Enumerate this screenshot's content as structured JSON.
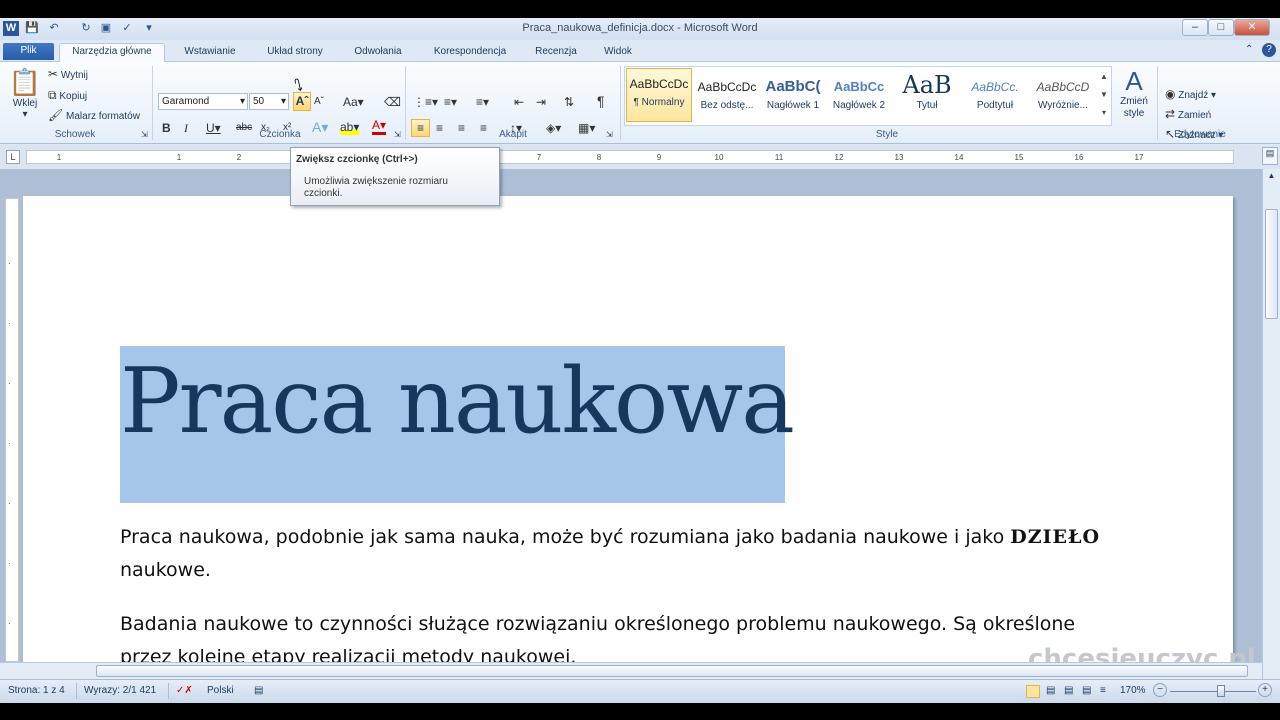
{
  "window": {
    "title": "Praca_naukowa_definicja.docx - Microsoft Word"
  },
  "tabs": [
    "Plik",
    "Narzędzia główne",
    "Wstawianie",
    "Układ strony",
    "Odwołania",
    "Korespondencja",
    "Recenzja",
    "Widok"
  ],
  "clipboard": {
    "paste": "Wklej",
    "cut": "Wytnij",
    "copy": "Kopiuj",
    "format_painter": "Malarz formatów",
    "label": "Schowek"
  },
  "font": {
    "name": "Garamond",
    "size": "50",
    "label": "Czcionka"
  },
  "paragraph": {
    "label": "Akapit"
  },
  "styles": {
    "label": "Style",
    "items": [
      {
        "preview": "AaBbCcDc",
        "name": "¶ Normalny"
      },
      {
        "preview": "AaBbCcDc",
        "name": "Bez odstę..."
      },
      {
        "preview": "AaBbC(",
        "name": "Nagłówek 1"
      },
      {
        "preview": "AaBbCc",
        "name": "Nagłówek 2"
      },
      {
        "preview": "AaB",
        "name": "Tytuł"
      },
      {
        "preview": "AaBbCc.",
        "name": "Podtytuł"
      },
      {
        "preview": "AaBbCcD",
        "name": "Wyróżnie..."
      }
    ],
    "change": "Zmień style"
  },
  "editing": {
    "find": "Znajdź",
    "replace": "Zamień",
    "select": "Zaznacz",
    "label": "Edytowanie"
  },
  "tooltip": {
    "title": "Zwiększ czcionkę (Ctrl+>)",
    "body": "Umożliwia zwiększenie rozmiaru czcionki."
  },
  "document": {
    "title": "Praca naukowa",
    "p1": "Praca naukowa, podobnie jak sama nauka, może być rozumiana jako badania naukowe i jako",
    "p1_word": "DZIEŁO",
    "p1_end": "naukowe.",
    "p2a": "Badania naukowe to czynności służące rozwiązaniu określonego problemu naukowego. Są określone",
    "p2b": "przez kolejne etapy realizacji metody naukowej."
  },
  "watermark": "chcesieuczyc.pl",
  "status": {
    "page": "Strona: 1 z 4",
    "words": "Wyrazy: 2/1 421",
    "language": "Polski",
    "zoom": "170%"
  },
  "colors": {
    "accent": "#2b579a",
    "selection": "#a6c5ea",
    "title_text": "#17375e"
  }
}
